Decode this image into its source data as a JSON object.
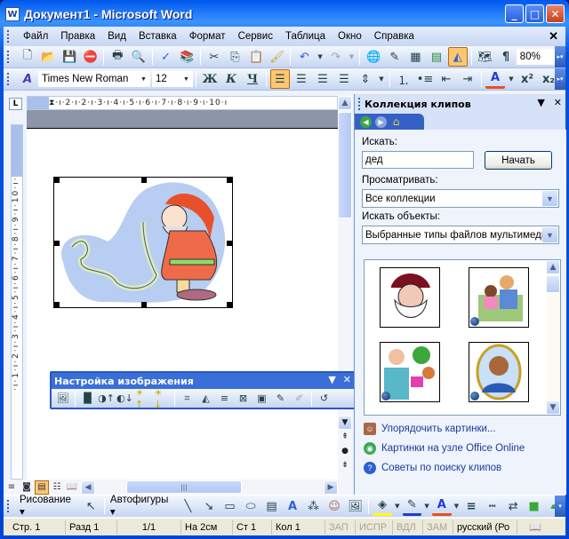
{
  "window": {
    "title": "Документ1 - Microsoft Word",
    "app_icon": "W",
    "controls": {
      "minimize": "_",
      "maximize": "□",
      "close": "✕"
    }
  },
  "menubar": {
    "items": [
      "Файл",
      "Правка",
      "Вид",
      "Вставка",
      "Формат",
      "Сервис",
      "Таблица",
      "Окно",
      "Справка"
    ],
    "close": "✕"
  },
  "standard_toolbar": {
    "icons": [
      "new-document",
      "open",
      "save",
      "permission",
      "print",
      "print-preview",
      "spelling",
      "research",
      "cut",
      "copy",
      "paste",
      "format-painter",
      "undo",
      "redo",
      "hyperlink",
      "tables-borders",
      "insert-table",
      "insert-excel",
      "drawing",
      "document-map",
      "show-formatting"
    ],
    "zoom": "80%"
  },
  "formatting_toolbar": {
    "style_icon": "styles",
    "font": "Times New Roman",
    "size": "12",
    "bold": "Ж",
    "italic": "К",
    "underline": "Ч",
    "font_color": "#e8501e",
    "superscript": "x²",
    "subscript": "x₂"
  },
  "ruler": {
    "corner": "L",
    "h_marks": [
      "1",
      "2",
      "1",
      "1",
      "2",
      "3",
      "4",
      "5",
      "6",
      "7",
      "8",
      "9",
      "10"
    ],
    "v_marks": [
      "2",
      "1",
      "1",
      "2",
      "3",
      "4",
      "5",
      "6",
      "7",
      "8",
      "9",
      "10",
      "11"
    ]
  },
  "picture_toolbar": {
    "title": "Настройка изображения",
    "icons": [
      "insert-picture",
      "color",
      "more-contrast",
      "less-contrast",
      "more-brightness",
      "less-brightness",
      "crop",
      "rotate-left",
      "line-style",
      "compress-pictures",
      "text-wrapping",
      "format-picture",
      "set-transparent-color",
      "reset-picture"
    ]
  },
  "task_pane": {
    "title": "Коллекция клипов",
    "search_label": "Искать:",
    "search_value": "дед",
    "go_button": "Начать",
    "browse_label": "Просматривать:",
    "browse_value": "Все коллекции",
    "types_label": "Искать объекты:",
    "types_value": "Выбранные типы файлов мультимеди",
    "results": [
      {
        "name": "santa-face-clip",
        "web": false
      },
      {
        "name": "grandfather-child-clip",
        "web": true
      },
      {
        "name": "grandparents-gift-clip",
        "web": true
      },
      {
        "name": "old-man-portrait-clip",
        "web": true
      }
    ],
    "links": [
      "Упорядочить картинки...",
      "Картинки на узле Office Online",
      "Советы по поиску клипов"
    ]
  },
  "drawing_toolbar": {
    "drawing": "Рисование ▾",
    "autoshapes": "Автофигуры ▾",
    "fill_color": "#ffff00",
    "line_color": "#1e3cd8",
    "font_color": "#e8501e"
  },
  "statusbar": {
    "page": "Стр. 1",
    "section": "Разд 1",
    "pages": "1/1",
    "at": "На 2см",
    "line": "Ст 1",
    "col": "Кол 1",
    "rec": "ЗАП",
    "trk": "ИСПР",
    "ext": "ВДЛ",
    "ovr": "ЗАМ",
    "language": "русский (Ро"
  }
}
